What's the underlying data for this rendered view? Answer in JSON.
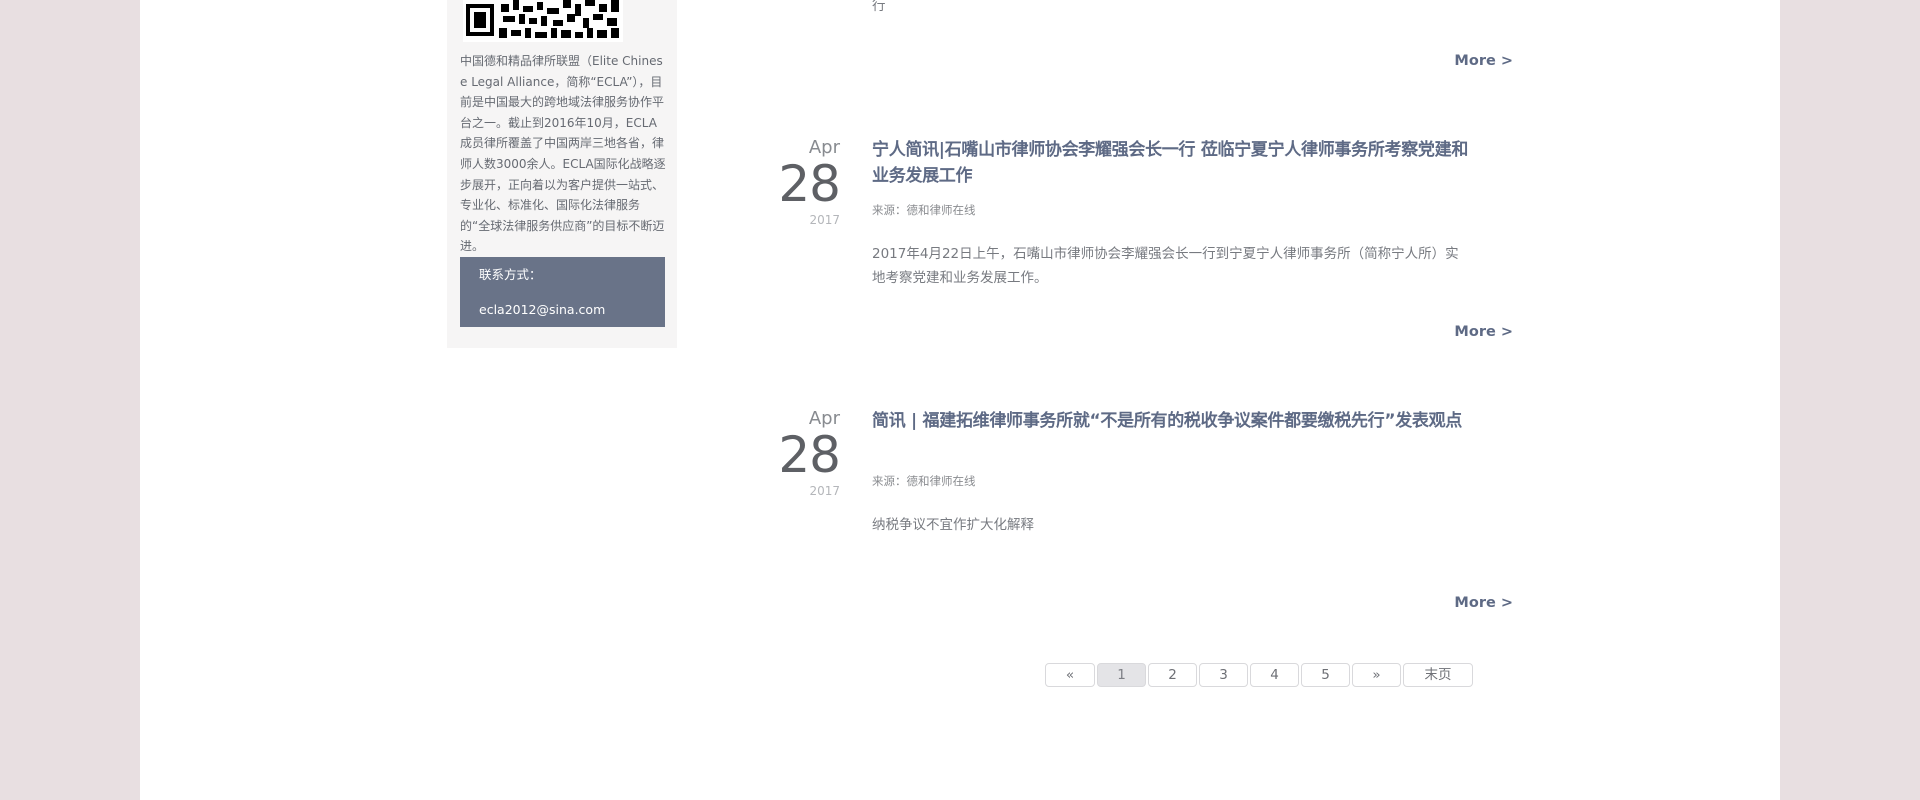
{
  "sidebar": {
    "description": "中国德和精品律所联盟（Elite Chinese Legal Alliance，简称“ECLA”），目前是中国最大的跨地域法律服务协作平台之一。截止到2016年10月，ECLA成员律所覆盖了中国两岸三地各省，律师人数3000余人。ECLA国际化战略逐步展开，正向着以为客户提供一站式、专业化、标准化、国际化法律服务的“全球法律服务供应商”的目标不断迈进。",
    "contact_label": "联系方式：",
    "contact_email": "ecla2012@sina.com"
  },
  "top_fragment": "行",
  "more_label": "More >",
  "articles": [
    {
      "month": "Apr",
      "day": "28",
      "year": "2017",
      "title": "宁人简讯|石嘴山市律师协会李耀强会长一行 莅临宁夏宁人律师事务所考察党建和业务发展工作",
      "source": "来源：德和律师在线",
      "summary": "2017年4月22日上午，石嘴山市律师协会李耀强会长一行到宁夏宁人律师事务所（简称宁人所）实地考察党建和业务发展工作。",
      "more": "More >"
    },
    {
      "month": "Apr",
      "day": "28",
      "year": "2017",
      "title": "简讯 | 福建拓维律师事务所就“不是所有的税收争议案件都要缴税先行”发表观点",
      "source": "来源：德和律师在线",
      "summary": "纳税争议不宜作扩大化解释",
      "more": "More >"
    }
  ],
  "pagination": {
    "prev": "«",
    "pages": [
      "1",
      "2",
      "3",
      "4",
      "5"
    ],
    "current": "1",
    "next": "»",
    "last": "末页"
  },
  "colors": {
    "background": "#e8dfe1",
    "accent": "#5e6a85",
    "contact_box": "#697388"
  }
}
